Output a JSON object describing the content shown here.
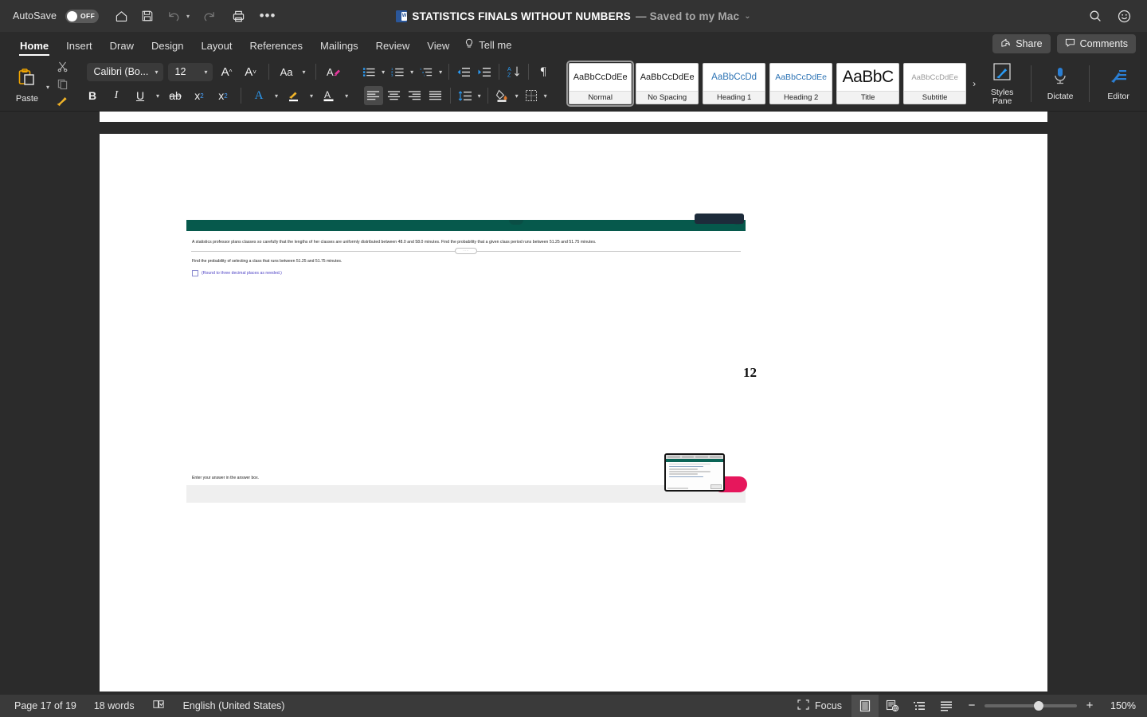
{
  "titlebar": {
    "autosave_label": "AutoSave",
    "autosave_state": "OFF",
    "doc_title": "STATISTICS FINALS WITHOUT NUMBERS",
    "save_state": "— Saved to my Mac",
    "icons": [
      "home-icon",
      "save-icon",
      "undo-icon",
      "redo-icon",
      "print-icon",
      "more-options-icon"
    ],
    "right_icons": [
      "search-icon",
      "account-icon"
    ]
  },
  "tabs": [
    {
      "label": "Home",
      "active": true
    },
    {
      "label": "Insert",
      "active": false
    },
    {
      "label": "Draw",
      "active": false
    },
    {
      "label": "Design",
      "active": false
    },
    {
      "label": "Layout",
      "active": false
    },
    {
      "label": "References",
      "active": false
    },
    {
      "label": "Mailings",
      "active": false
    },
    {
      "label": "Review",
      "active": false
    },
    {
      "label": "View",
      "active": false
    }
  ],
  "tellme": "Tell me",
  "share_label": "Share",
  "comments_label": "Comments",
  "ribbon": {
    "paste_label": "Paste",
    "font_name": "Calibri (Bo...",
    "font_size": "12",
    "grow_font": "A",
    "shrink_font": "A",
    "change_case": "Aa",
    "clear_formatting": "A",
    "bold": "B",
    "italic": "I",
    "underline": "U",
    "strikethrough": "ab",
    "subscript": "x",
    "superscript": "x",
    "text_effects": "A",
    "highlight": "A",
    "font_color": "A",
    "styles_pane_l1": "Styles",
    "styles_pane_l2": "Pane",
    "dictate_label": "Dictate",
    "editor_label": "Editor"
  },
  "styles": [
    {
      "preview": "AaBbCcDdEe",
      "name": "Normal",
      "active": true
    },
    {
      "preview": "AaBbCcDdEe",
      "name": "No Spacing",
      "active": false
    },
    {
      "preview": "AaBbCcDd",
      "name": "Heading 1",
      "active": false
    },
    {
      "preview": "AaBbCcDdEe",
      "name": "Heading 2",
      "active": false
    },
    {
      "preview": "AaBbC",
      "name": "Title",
      "active": false
    },
    {
      "preview": "AaBbCcDdEe",
      "name": "Subtitle",
      "active": false
    }
  ],
  "gallery_more": "›",
  "document": {
    "embedded": {
      "header_color": "#06594c",
      "question": "A statistics professor plans classes so carefully that the lengths of her classes are uniformly distributed between 48.0 and 58.0 minutes. Find the probability that a given class period runs between 51.25 and 51.75 minutes.",
      "divider_label": "·····",
      "subquestion": "Find the probability of selecting a class that runs between 51.25 and 51.75 minutes.",
      "answer_hint": "(Round to three decimal places as needed.)",
      "footer_text": "Enter your answer in the answer box."
    },
    "page_number": "12",
    "blob_color": "#e6175c"
  },
  "statusbar": {
    "page": "Page 17 of 19",
    "words": "18 words",
    "proofing_icon": "spell-check-icon",
    "language": "English (United States)",
    "focus_label": "Focus",
    "views": [
      "print-layout-icon",
      "web-layout-icon",
      "outline-icon",
      "draft-icon"
    ],
    "zoom_minus": "−",
    "zoom_plus": "+",
    "zoom_level": "150%"
  }
}
